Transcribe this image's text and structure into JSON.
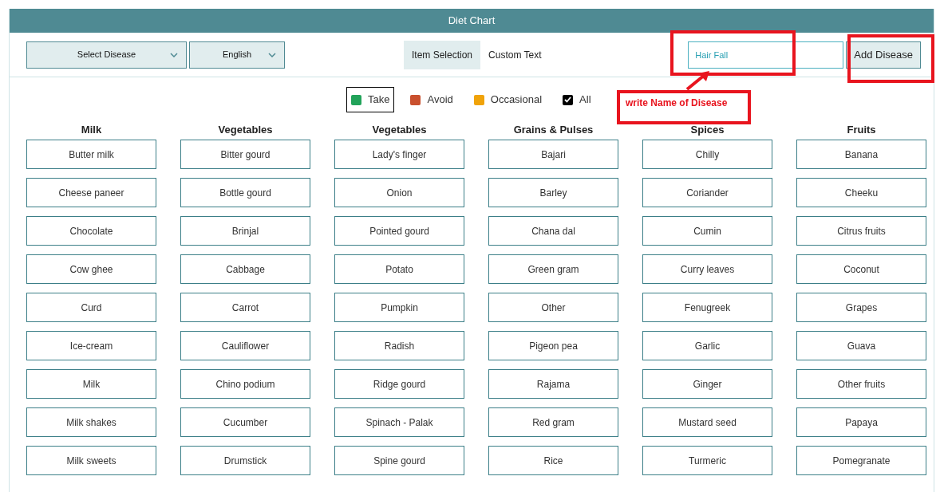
{
  "header": {
    "title": "Diet Chart"
  },
  "toolbar": {
    "dropdowns": [
      {
        "label": "Select Disease"
      },
      {
        "label": "English"
      }
    ],
    "tabs": [
      {
        "label": "Item Selection",
        "selected": true
      },
      {
        "label": "Custom Text",
        "selected": false
      }
    ],
    "disease_field": {
      "value": "Hair Fall"
    },
    "add_button": "Add Disease"
  },
  "legend": [
    {
      "kind": "swatch",
      "label": "Take",
      "color": "#22a35a",
      "selected": true
    },
    {
      "kind": "swatch",
      "label": "Avoid",
      "color": "#c9502e",
      "selected": false
    },
    {
      "kind": "swatch",
      "label": "Occasional",
      "color": "#f0a30a",
      "selected": false
    },
    {
      "kind": "checkbox",
      "label": "All",
      "checked": true,
      "selected": false
    }
  ],
  "annotation": {
    "callout": "write Name of Disease"
  },
  "columns": [
    {
      "title": "Milk",
      "items": [
        "Butter milk",
        "Cheese paneer",
        "Chocolate",
        "Cow ghee",
        "Curd",
        "Ice-cream",
        "Milk",
        "Milk shakes",
        "Milk sweets"
      ]
    },
    {
      "title": "Vegetables",
      "items": [
        "Bitter gourd",
        "Bottle gourd",
        "Brinjal",
        "Cabbage",
        "Carrot",
        "Cauliflower",
        "Chino podium",
        "Cucumber",
        "Drumstick"
      ]
    },
    {
      "title": "Vegetables",
      "items": [
        "Lady's finger",
        "Onion",
        "Pointed gourd",
        "Potato",
        "Pumpkin",
        "Radish",
        "Ridge gourd",
        "Spinach - Palak",
        "Spine gourd"
      ]
    },
    {
      "title": "Grains & Pulses",
      "items": [
        "Bajari",
        "Barley",
        "Chana dal",
        "Green gram",
        "Other",
        "Pigeon pea",
        "Rajama",
        "Red gram",
        "Rice"
      ]
    },
    {
      "title": "Spices",
      "items": [
        "Chilly",
        "Coriander",
        "Cumin",
        "Curry leaves",
        "Fenugreek",
        "Garlic",
        "Ginger",
        "Mustard seed",
        "Turmeric"
      ]
    },
    {
      "title": "Fruits",
      "items": [
        "Banana",
        "Cheeku",
        "Citrus fruits",
        "Coconut",
        "Grapes",
        "Guava",
        "Other fruits",
        "Papaya",
        "Pomegranate"
      ]
    }
  ]
}
